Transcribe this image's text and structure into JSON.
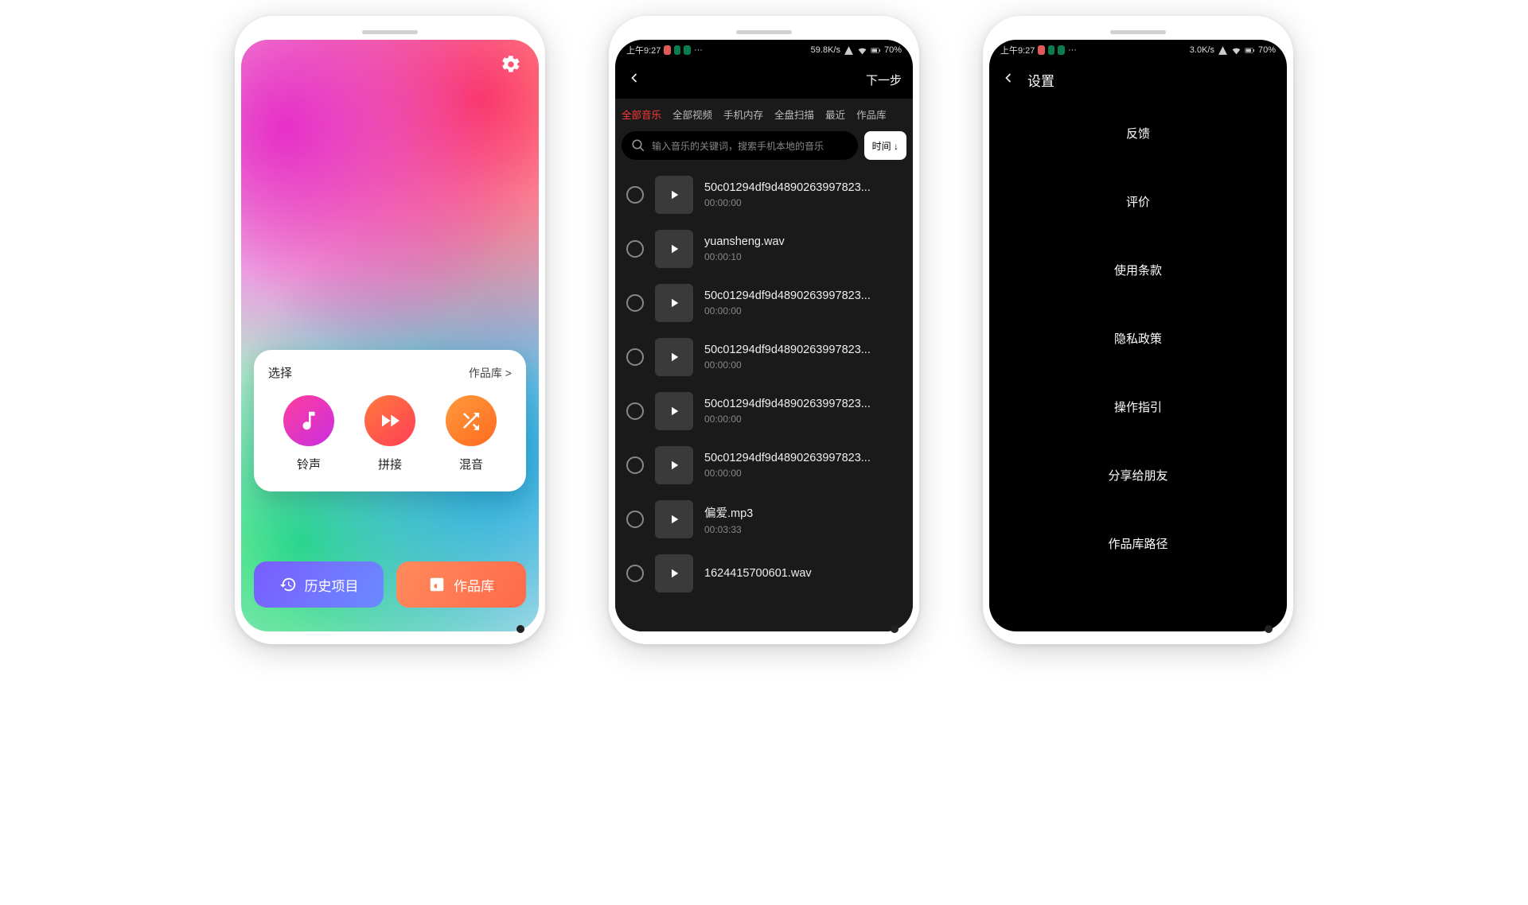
{
  "phone1": {
    "card_title": "选择",
    "library_link": "作品库 >",
    "tools": [
      {
        "label": "铃声"
      },
      {
        "label": "拼接"
      },
      {
        "label": "混音"
      }
    ],
    "history_btn": "历史项目",
    "library_btn": "作品库"
  },
  "phone2": {
    "status": {
      "time": "上午9:27",
      "speed": "59.8K/s",
      "battery": "70%"
    },
    "nav_next": "下一步",
    "tabs": [
      "全部音乐",
      "全部视频",
      "手机内存",
      "全盘扫描",
      "最近",
      "作品库"
    ],
    "search_placeholder": "输入音乐的关键词，搜索手机本地的音乐",
    "sort_label": "时间 ↓",
    "files": [
      {
        "name": "50c01294df9d4890263997823...",
        "dur": "00:00:00"
      },
      {
        "name": "yuansheng.wav",
        "dur": "00:00:10"
      },
      {
        "name": "50c01294df9d4890263997823...",
        "dur": "00:00:00"
      },
      {
        "name": "50c01294df9d4890263997823...",
        "dur": "00:00:00"
      },
      {
        "name": "50c01294df9d4890263997823...",
        "dur": "00:00:00"
      },
      {
        "name": "50c01294df9d4890263997823...",
        "dur": "00:00:00"
      },
      {
        "name": "偏爱.mp3",
        "dur": "00:03:33"
      },
      {
        "name": "1624415700601.wav",
        "dur": ""
      }
    ]
  },
  "phone3": {
    "status": {
      "time": "上午9:27",
      "speed": "3.0K/s",
      "battery": "70%"
    },
    "title": "设置",
    "items": [
      "反馈",
      "评价",
      "使用条款",
      "隐私政策",
      "操作指引",
      "分享给朋友",
      "作品库路径"
    ]
  }
}
